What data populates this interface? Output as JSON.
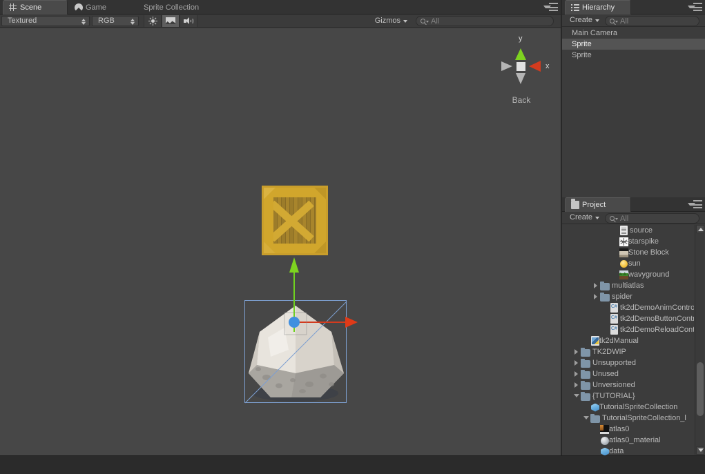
{
  "scene_view": {
    "tabs": [
      {
        "label": "Scene",
        "icon": "scene-grid-icon",
        "active": true
      },
      {
        "label": "Game",
        "icon": "game-pacman-icon",
        "active": false
      },
      {
        "label": "Sprite Collection",
        "icon": "none",
        "active": false
      }
    ],
    "toolbar": {
      "draw_mode": "Textured",
      "color_mode": "RGB",
      "lighting_icon": "sun-icon",
      "effects_icon": "image-icon",
      "audio_icon": "speaker-icon",
      "gizmos_label": "Gizmos",
      "search_placeholder": "All"
    },
    "axis_widget": {
      "y_label": "y",
      "x_label": "x",
      "view_label": "Back",
      "x_color": "#d23b1e",
      "y_color": "#7ed320"
    },
    "objects": {
      "crate_sprite": "crate-sprite",
      "rock_mesh": "rock-mesh",
      "selection_outline_color": "#7d9fd0",
      "move_gizmo_center_color": "#3f8fe0"
    }
  },
  "hierarchy": {
    "tab_label": "Hierarchy",
    "create_label": "Create",
    "search_placeholder": "All",
    "items": [
      {
        "label": "Main Camera",
        "selected": false
      },
      {
        "label": "Sprite",
        "selected": true
      },
      {
        "label": "Sprite",
        "selected": false
      }
    ]
  },
  "project": {
    "tab_label": "Project",
    "create_label": "Create",
    "search_placeholder": "All",
    "rows": [
      {
        "label": "source",
        "icon": "document-icon",
        "indent": 5,
        "tri": "none"
      },
      {
        "label": "starspike",
        "icon": "starspike-icon",
        "indent": 5,
        "tri": "none"
      },
      {
        "label": "Stone Block",
        "icon": "stone-icon",
        "indent": 5,
        "tri": "none"
      },
      {
        "label": "sun",
        "icon": "sun-texture-icon",
        "indent": 5,
        "tri": "none"
      },
      {
        "label": "wavyground",
        "icon": "wavy-icon",
        "indent": 5,
        "tri": "none"
      },
      {
        "label": "multiatlas",
        "icon": "folder-icon",
        "indent": 3,
        "tri": "closed"
      },
      {
        "label": "spider",
        "icon": "folder-icon",
        "indent": 3,
        "tri": "closed"
      },
      {
        "label": "tk2dDemoAnimContro",
        "icon": "csharp-icon",
        "indent": 4,
        "tri": "none"
      },
      {
        "label": "tk2dDemoButtonContr",
        "icon": "csharp-icon",
        "indent": 4,
        "tri": "none"
      },
      {
        "label": "tk2dDemoReloadConti",
        "icon": "csharp-icon",
        "indent": 4,
        "tri": "none"
      },
      {
        "label": "tk2dManual",
        "icon": "manual-icon",
        "indent": 2,
        "tri": "none"
      },
      {
        "label": "TK2DWIP",
        "icon": "folder-icon",
        "indent": 1,
        "tri": "closed"
      },
      {
        "label": "Unsupported",
        "icon": "folder-icon",
        "indent": 1,
        "tri": "closed"
      },
      {
        "label": "Unused",
        "icon": "folder-icon",
        "indent": 1,
        "tri": "closed"
      },
      {
        "label": "Unversioned",
        "icon": "folder-icon",
        "indent": 1,
        "tri": "closed"
      },
      {
        "label": "{TUTORIAL}",
        "icon": "folder-icon",
        "indent": 1,
        "tri": "open"
      },
      {
        "label": "TutorialSpriteCollection",
        "icon": "prefab-icon",
        "indent": 2,
        "tri": "none"
      },
      {
        "label": "TutorialSpriteCollection_l",
        "icon": "folder-icon",
        "indent": 2,
        "tri": "open"
      },
      {
        "label": "atlas0",
        "icon": "atlas-texture-icon",
        "indent": 3,
        "tri": "none"
      },
      {
        "label": "atlas0_material",
        "icon": "material-icon",
        "indent": 3,
        "tri": "none"
      },
      {
        "label": "data",
        "icon": "prefab-icon",
        "indent": 3,
        "tri": "none"
      }
    ]
  },
  "status_bar": {
    "text": ""
  }
}
